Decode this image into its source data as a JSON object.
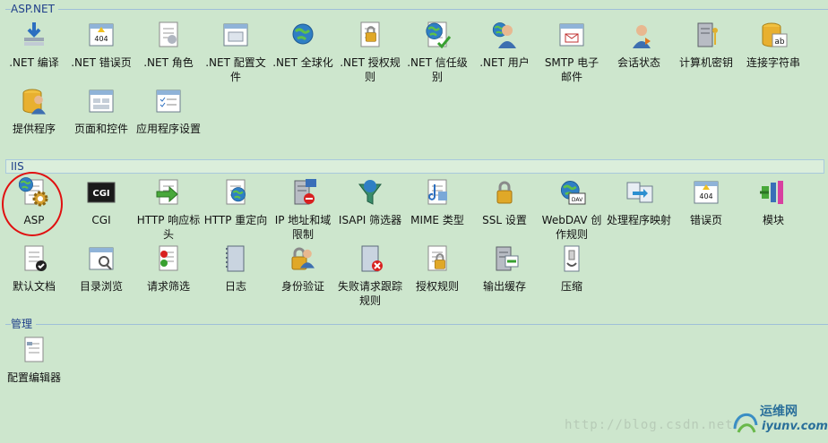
{
  "sections": {
    "aspnet": {
      "title": "ASP.NET",
      "items": [
        {
          "label": ".NET 编译",
          "icon": "download-compile-icon"
        },
        {
          "label": ".NET 错误页",
          "icon": "error-404-icon"
        },
        {
          "label": ".NET 角色",
          "icon": "roles-icon"
        },
        {
          "label": ".NET 配置文件",
          "icon": "profile-config-icon"
        },
        {
          "label": ".NET 全球化",
          "icon": "globe-icon"
        },
        {
          "label": ".NET 授权规则",
          "icon": "lock-document-icon"
        },
        {
          "label": ".NET 信任级别",
          "icon": "globe-check-icon"
        },
        {
          "label": ".NET 用户",
          "icon": "user-globe-icon"
        },
        {
          "label": "SMTP 电子邮件",
          "icon": "email-icon"
        },
        {
          "label": "会话状态",
          "icon": "session-state-icon"
        },
        {
          "label": "计算机密钥",
          "icon": "server-key-icon"
        },
        {
          "label": "连接字符串",
          "icon": "database-ab-icon"
        },
        {
          "label": "提供程序",
          "icon": "provider-icon"
        },
        {
          "label": "页面和控件",
          "icon": "page-controls-icon"
        },
        {
          "label": "应用程序设置",
          "icon": "app-settings-icon"
        }
      ]
    },
    "iis": {
      "title": "IIS",
      "items": [
        {
          "label": "ASP",
          "icon": "asp-gear-icon"
        },
        {
          "label": "CGI",
          "icon": "cgi-icon"
        },
        {
          "label": "HTTP 响应标头",
          "icon": "http-headers-icon"
        },
        {
          "label": "HTTP 重定向",
          "icon": "http-redirect-icon"
        },
        {
          "label": "IP 地址和域限制",
          "icon": "ip-restriction-icon"
        },
        {
          "label": "ISAPI 筛选器",
          "icon": "isapi-filter-icon"
        },
        {
          "label": "MIME 类型",
          "icon": "mime-types-icon"
        },
        {
          "label": "SSL 设置",
          "icon": "ssl-lock-icon"
        },
        {
          "label": "WebDAV 创作规则",
          "icon": "webdav-icon"
        },
        {
          "label": "处理程序映射",
          "icon": "handler-mappings-icon"
        },
        {
          "label": "错误页",
          "icon": "error-page-icon"
        },
        {
          "label": "模块",
          "icon": "modules-icon"
        },
        {
          "label": "默认文档",
          "icon": "default-document-icon"
        },
        {
          "label": "目录浏览",
          "icon": "directory-browsing-icon"
        },
        {
          "label": "请求筛选",
          "icon": "request-filtering-icon"
        },
        {
          "label": "日志",
          "icon": "logging-icon"
        },
        {
          "label": "身份验证",
          "icon": "authentication-icon"
        },
        {
          "label": "失败请求跟踪规则",
          "icon": "failed-request-icon"
        },
        {
          "label": "授权规则",
          "icon": "authorization-icon"
        },
        {
          "label": "输出缓存",
          "icon": "output-cache-icon"
        },
        {
          "label": "压缩",
          "icon": "compression-icon"
        }
      ]
    },
    "management": {
      "title": "管理",
      "items": [
        {
          "label": "配置编辑器",
          "icon": "config-editor-icon"
        }
      ]
    }
  },
  "watermark": "http://blog.csdn.net/",
  "logo": {
    "line1": "运维网",
    "line2": "iyunv.com"
  },
  "colors": {
    "background": "#cde6cd",
    "section_title": "#1f3f8a",
    "highlight": "#e01010"
  }
}
